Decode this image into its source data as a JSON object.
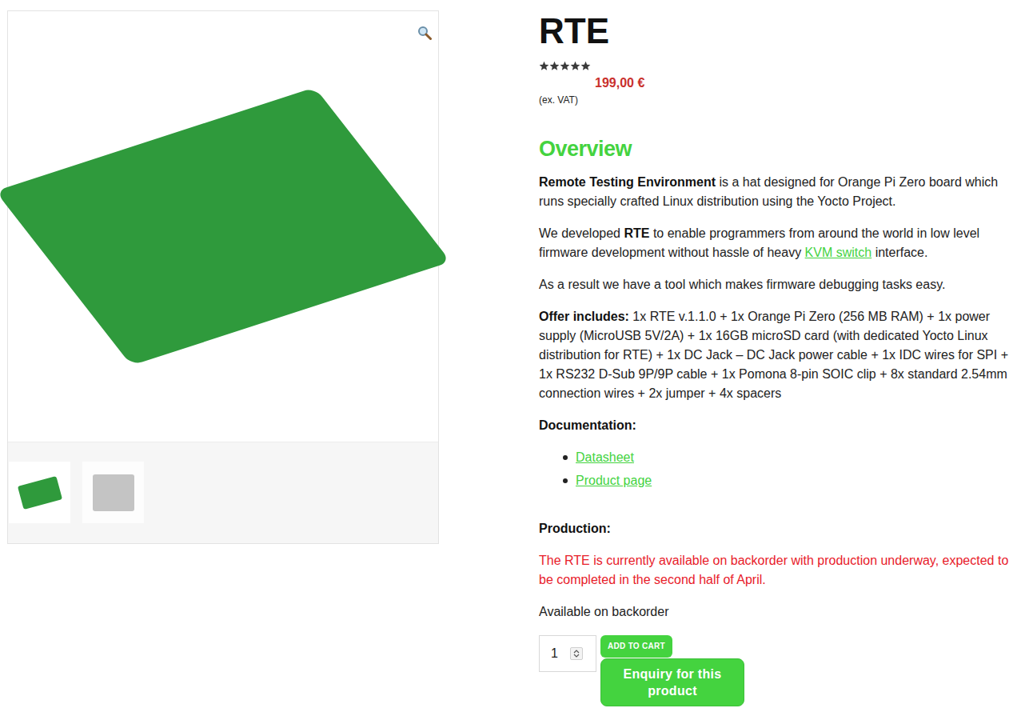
{
  "product": {
    "title": "RTE",
    "stars": 5,
    "price": "199,00 €",
    "vat_note": "(ex. VAT)",
    "thumbnails": [
      {
        "selected": true
      },
      {
        "selected": false
      }
    ]
  },
  "overview": {
    "heading": "Overview",
    "paragraphs": [
      {
        "runs": [
          {
            "text": "Remote Testing Environment",
            "kind": "bold"
          },
          {
            "text": " is a hat designed for Orange Pi Zero board which runs specially crafted Linux distribution using the Yocto Project.",
            "kind": "plain"
          }
        ]
      },
      {
        "runs": [
          {
            "text": "We developed ",
            "kind": "plain"
          },
          {
            "text": "RTE",
            "kind": "bold"
          },
          {
            "text": " to enable programmers from around the world in low level firmware development without hassle of heavy ",
            "kind": "plain"
          },
          {
            "text": "KVM switch",
            "kind": "link"
          },
          {
            "text": " interface.",
            "kind": "plain"
          }
        ]
      },
      {
        "runs": [
          {
            "text": "As a result we have a tool which makes firmware debugging tasks easy.",
            "kind": "plain"
          }
        ]
      },
      {
        "runs": [
          {
            "text": "Offer includes:",
            "kind": "bold"
          },
          {
            "text": " 1x RTE v.1.1.0 + 1x Orange Pi Zero (256 MB RAM) + 1x power supply (MicroUSB 5V/2A) + 1x 16GB microSD card (with dedicated Yocto Linux distribution for RTE) + 1x DC Jack – DC Jack power cable + 1x IDC wires for SPI + 1x RS232 D-Sub 9P/9P cable + 1x Pomona 8-pin SOIC clip + 8x standard 2.54mm connection wires + 2x jumper + 4x spacers",
            "kind": "plain"
          }
        ]
      }
    ]
  },
  "documentation": {
    "label": "Documentation:",
    "links": [
      "Datasheet",
      "Product page"
    ]
  },
  "production": {
    "label": "Production:",
    "notice": "The RTE is currently available on backorder with production underway, expected to be completed in the second half of April.",
    "availability": "Available on backorder"
  },
  "cart": {
    "quantity": "1",
    "add_button": "ADD TO CART",
    "enquiry_button": "Enquiry for this product"
  }
}
